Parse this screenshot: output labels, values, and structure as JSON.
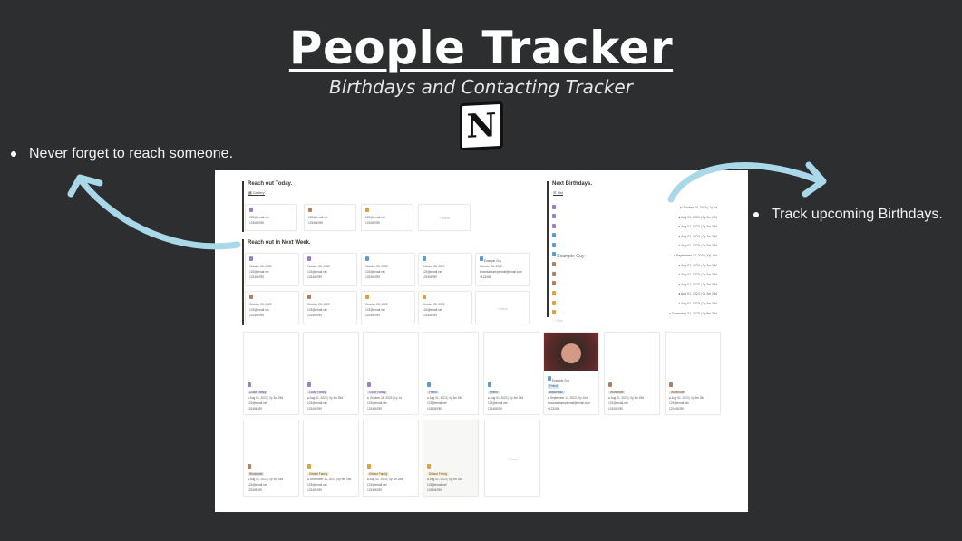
{
  "header": {
    "title": "People Tracker",
    "subtitle": "Birthdays and Contacting Tracker",
    "logo_letter": "N"
  },
  "bullets": {
    "left": "Never forget to reach someone.",
    "right": "Track upcoming Birthdays."
  },
  "colors": {
    "background": "#2c2e30",
    "arrow": "#a9d9e9",
    "purple": "#9a7fd1",
    "blue": "#5b9bd5",
    "brown": "#b08060",
    "orange": "#e0a040"
  },
  "today": {
    "heading": "Reach out Today.",
    "view_tab": "Gallery",
    "new_label": "+ New",
    "cards": [
      {
        "icon": "purple",
        "email": "123@email.net",
        "phone": "123456789"
      },
      {
        "icon": "brown",
        "email": "123@email.net",
        "phone": "123456789"
      },
      {
        "icon": "orange",
        "email": "123@email.net",
        "phone": "123456789"
      }
    ]
  },
  "week": {
    "heading": "Reach out in Next Week.",
    "new_label": "+ New",
    "cards": [
      {
        "icon": "purple",
        "name": "",
        "date": "October 26, 2022",
        "email": "123@email.net",
        "phone": "123456789"
      },
      {
        "icon": "purple",
        "name": "",
        "date": "October 26, 2022",
        "email": "123@email.net",
        "phone": "123456789"
      },
      {
        "icon": "blue",
        "name": "",
        "date": "October 26, 2022",
        "email": "123@email.net",
        "phone": "123456789"
      },
      {
        "icon": "blue",
        "name": "",
        "date": "October 26, 2022",
        "email": "123@email.net",
        "phone": "123456789"
      },
      {
        "icon": "blue",
        "name": "Example Guy",
        "date": "October 26, 2022",
        "email": "brownlaexamplemail@email.com",
        "phone": "+123456"
      },
      {
        "icon": "brown",
        "name": "",
        "date": "October 26, 2022",
        "email": "123@email.net",
        "phone": "123456789"
      },
      {
        "icon": "brown",
        "name": "",
        "date": "October 26, 2022",
        "email": "123@email.net",
        "phone": "123456789"
      },
      {
        "icon": "orange",
        "name": "",
        "date": "October 26, 2022",
        "email": "123@email.net",
        "phone": "123456789"
      },
      {
        "icon": "orange",
        "name": "",
        "date": "October 26, 2022",
        "email": "123@email.net",
        "phone": "123456789"
      }
    ]
  },
  "birthdays": {
    "heading": "Next Birthdays.",
    "view_tab": "List",
    "new_label": "+ New",
    "rows": [
      {
        "icon": "purple",
        "name": "",
        "date": "October 24, 2023 | 1y 1d"
      },
      {
        "icon": "purple",
        "name": "",
        "date": "Aug 01, 2023 | 0y 3m 25d"
      },
      {
        "icon": "purple",
        "name": "",
        "date": "Aug 01, 2023 | 0y 3m 25d"
      },
      {
        "icon": "blue",
        "name": "",
        "date": "Aug 01, 2023 | 0y 3m 25d"
      },
      {
        "icon": "blue",
        "name": "",
        "date": "Aug 01, 2023 | 0y 3m 25d"
      },
      {
        "icon": "blue",
        "name": "Example Guy",
        "date": "September 17, 2023 | 0y 10d"
      },
      {
        "icon": "brown",
        "name": "",
        "date": "Aug 01, 2023 | 0y 3m 25d"
      },
      {
        "icon": "brown",
        "name": "",
        "date": "Aug 01, 2023 | 0y 3m 25d"
      },
      {
        "icon": "brown",
        "name": "",
        "date": "Aug 01, 2023 | 0y 3m 25d"
      },
      {
        "icon": "orange",
        "name": "",
        "date": "Aug 01, 2023 | 0y 3m 25d"
      },
      {
        "icon": "orange",
        "name": "",
        "date": "Aug 01, 2023 | 0y 3m 25d"
      },
      {
        "icon": "orange",
        "name": "",
        "date": "December 31, 2023 | 0y 9m 25d"
      }
    ]
  },
  "gallery": {
    "new_label": "+ New",
    "cards": [
      {
        "icon": "purple",
        "name": "",
        "tags": [
          "Close Family"
        ],
        "tagcolor": "#e8defa",
        "date": "Aug 01, 2023 | 0y 3m 25d",
        "email": "123@email.net",
        "phone": "123456789"
      },
      {
        "icon": "purple",
        "name": "",
        "tags": [
          "Close Family"
        ],
        "tagcolor": "#e8defa",
        "date": "Aug 01, 2023 | 0y 3m 25d",
        "email": "123@email.net",
        "phone": "123456789"
      },
      {
        "icon": "purple",
        "name": "",
        "tags": [
          "Close Family"
        ],
        "tagcolor": "#e8defa",
        "date": "October 24, 2023 | 1y 1d",
        "email": "123@email.net",
        "phone": "123456789"
      },
      {
        "icon": "blue",
        "name": "",
        "tags": [
          "Friend"
        ],
        "tagcolor": "#d8e8f6",
        "date": "Aug 01, 2023 | 0y 3m 25d",
        "email": "123@email.net",
        "phone": "123456789"
      },
      {
        "icon": "blue",
        "name": "",
        "tags": [
          "Friend"
        ],
        "tagcolor": "#d8e8f6",
        "date": "Aug 01, 2023 | 0y 3m 25d",
        "email": "123@email.net",
        "phone": "123456789"
      },
      {
        "icon": "blue",
        "name": "Example Guy",
        "photo": true,
        "tags": [
          "Friend",
          "Basketball"
        ],
        "tagcolor": "#d8e8f6",
        "date": "September 17, 2023 | 0y 10d",
        "email": "brownlaexamplemail@email.com",
        "phone": "+123456"
      },
      {
        "icon": "brown",
        "name": "",
        "tags": [
          "Workmate"
        ],
        "tagcolor": "#f1e3d8",
        "date": "Aug 01, 2023 | 0y 3m 25d",
        "email": "123@email.net",
        "phone": "123456789"
      },
      {
        "icon": "brown",
        "name": "",
        "tags": [
          "Workmate"
        ],
        "tagcolor": "#f1e3d8",
        "date": "Aug 01, 2023 | 0y 3m 25d",
        "email": "123@email.net",
        "phone": "123456789"
      },
      {
        "icon": "brown",
        "name": "",
        "tags": [
          "Workmate"
        ],
        "tagcolor": "#f1e3d8",
        "date": "Aug 01, 2023 | 0y 3m 25d",
        "email": "123@email.net",
        "phone": "123456789"
      },
      {
        "icon": "orange",
        "name": "",
        "tags": [
          "Distant Family"
        ],
        "tagcolor": "#fbecc9",
        "date": "December 31, 2023 | 0y 9m 25d",
        "email": "123@email.net",
        "phone": "123456789"
      },
      {
        "icon": "orange",
        "name": "",
        "tags": [
          "Distant Family"
        ],
        "tagcolor": "#fbecc9",
        "date": "Aug 01, 2023 | 0y 3m 25d",
        "email": "123@email.net",
        "phone": "123456789"
      },
      {
        "icon": "orange",
        "name": "",
        "tags": [
          "Distant Family"
        ],
        "tagcolor": "#fbecc9",
        "date": "Aug 01, 2023 | 0y 3m 25d",
        "email": "123@email.net",
        "phone": "123456789"
      }
    ]
  }
}
